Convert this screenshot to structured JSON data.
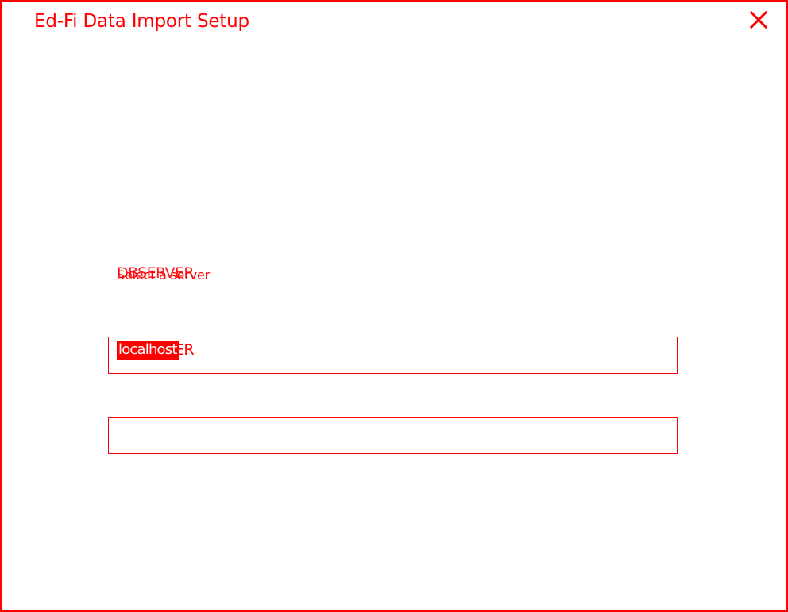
{
  "window": {
    "title": "Ed-Fi Data Import Setup",
    "close_icon": "close-icon"
  },
  "overlay_labels": {
    "back_text": "DBSERVER",
    "front_text": "Select a server"
  },
  "server_field": {
    "ghost_text": "DBSERVER",
    "value": "localhost"
  },
  "database_field": {
    "value": ""
  },
  "colors": {
    "accent": "#ff0000",
    "background": "#ffffff"
  }
}
